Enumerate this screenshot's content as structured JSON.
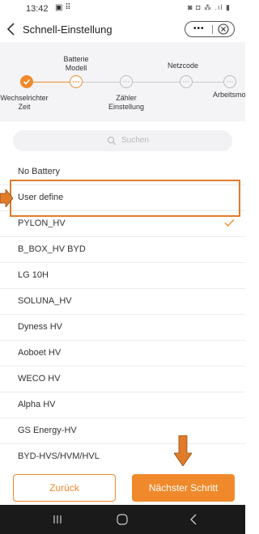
{
  "status_bar": {
    "time": "13:42",
    "notification_icons": "▣ ⠿",
    "system_icons": "◙ ◘ ⁂ .ıl ▮"
  },
  "header": {
    "title": "Schnell-Einstellung",
    "more_label": "•••"
  },
  "steps": [
    {
      "label": "Wechselrichter\nZeit",
      "state": "done",
      "label_position": "below"
    },
    {
      "label": "Batterie\nModell",
      "state": "current",
      "label_position": "above"
    },
    {
      "label": "Zähler\nEinstellung",
      "state": "todo",
      "label_position": "below"
    },
    {
      "label": "Netzcode",
      "state": "todo",
      "label_position": "above"
    },
    {
      "label": "Arbeitsmo",
      "state": "todo",
      "label_position": "below"
    }
  ],
  "search": {
    "placeholder": "Suchen"
  },
  "battery_list": {
    "items": [
      "No Battery",
      "User define",
      "PYLON_HV",
      "B_BOX_HV BYD",
      "LG 10H",
      "SOLUNA_HV",
      "Dyness HV",
      "Aoboet HV",
      "WECO HV",
      "Alpha HV",
      "GS Energy-HV",
      "BYD-HVS/HVM/HVL"
    ],
    "selected": "PYLON_HV"
  },
  "footer": {
    "back_label": "Zurück",
    "next_label": "Nächster Schritt"
  },
  "colors": {
    "accent": "#f0892b",
    "highlight": "#e07b2a",
    "navbar": "#1a1a1a"
  }
}
